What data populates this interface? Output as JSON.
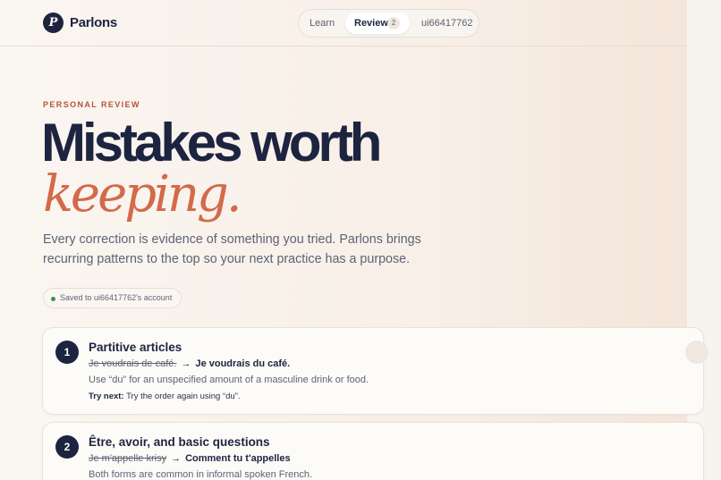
{
  "header": {
    "logo_letter": "P",
    "brand": "Parlons",
    "nav": {
      "learn": "Learn",
      "review": "Review",
      "review_count": "2",
      "user": "ui66417762"
    }
  },
  "hero": {
    "eyebrow": "PERSONAL REVIEW",
    "title_line1": "Mistakes worth",
    "title_line2": "keeping.",
    "lead": "Every correction is evidence of something you tried. Parlons brings recurring patterns to the top so your next practice has a purpose.",
    "saved": "Saved to ui66417762's account"
  },
  "mistakes": [
    {
      "number": "1",
      "title": "Partitive articles",
      "wrong": "Je voudrais de café.",
      "arrow": "→",
      "correct": "Je voudrais du café.",
      "explanation": "Use “du” for an unspecified amount of a masculine drink or food.",
      "next_label": "Try next:",
      "next_text": "Try the order again using “du”."
    },
    {
      "number": "2",
      "title": "Être, avoir, and basic questions",
      "wrong": "Je m'appelle krisy",
      "arrow": "→",
      "correct": "Comment tu t'appelles",
      "explanation": "Both forms are common in informal spoken French."
    }
  ],
  "colors": {
    "navy": "#1d2440",
    "accent": "#d36a4a",
    "eyebrow": "#b5543a",
    "success_dot": "#3d8c5a"
  }
}
